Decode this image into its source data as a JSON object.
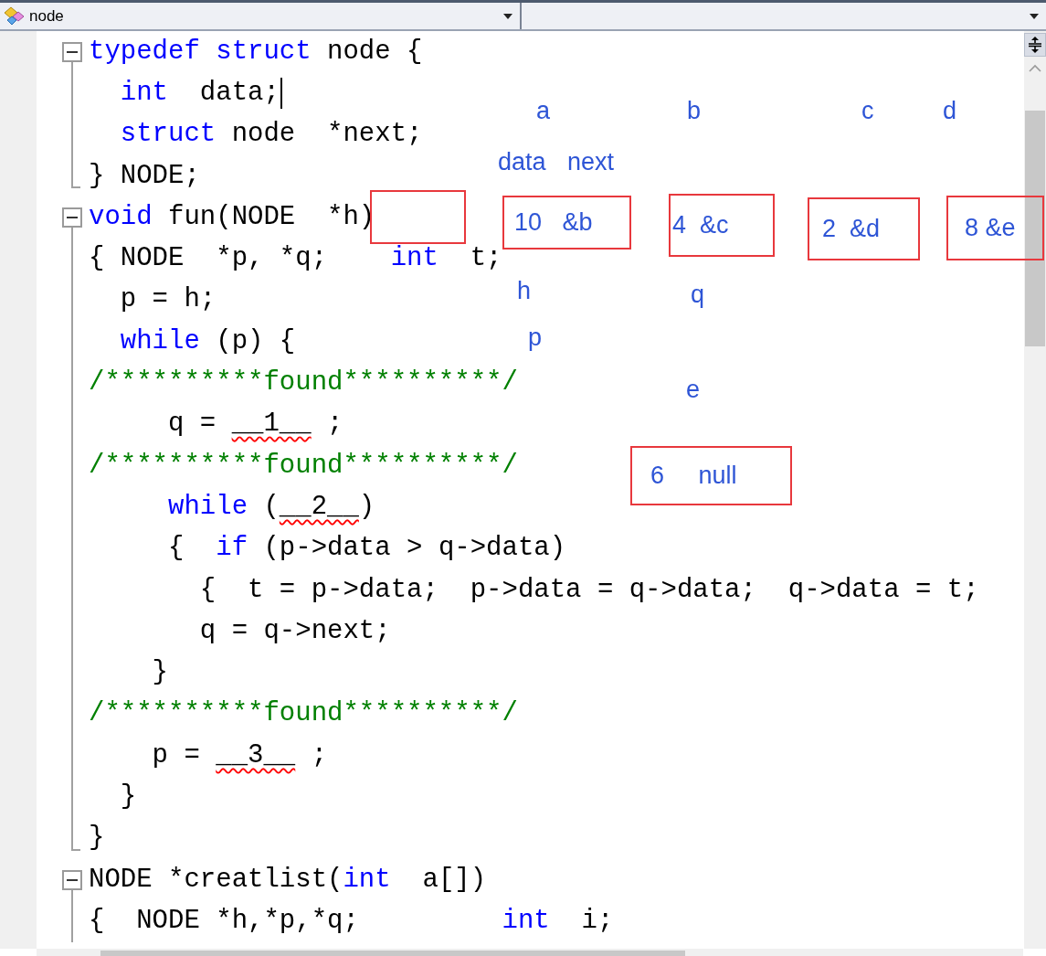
{
  "toolbar": {
    "scope_dropdown": {
      "value": "node"
    }
  },
  "code_lines": [
    {
      "kind": "fold_start",
      "caret": false,
      "tokens": [
        {
          "kind": "kw",
          "text": "typedef struct"
        },
        {
          "kind": "plain",
          "text": " node {"
        }
      ]
    },
    {
      "kind": "body",
      "caret": true,
      "tokens": [
        {
          "kind": "kw",
          "text": "  int"
        },
        {
          "kind": "plain",
          "text": "  data;"
        }
      ]
    },
    {
      "kind": "body",
      "caret": false,
      "tokens": [
        {
          "kind": "kw",
          "text": "  struct"
        },
        {
          "kind": "plain",
          "text": " node  *next;"
        }
      ]
    },
    {
      "kind": "fold_end",
      "caret": false,
      "tokens": [
        {
          "kind": "plain",
          "text": "} NODE;"
        }
      ]
    },
    {
      "kind": "fold_start",
      "caret": false,
      "tokens": [
        {
          "kind": "kw",
          "text": "void"
        },
        {
          "kind": "plain",
          "text": " fun(NODE  *h)"
        }
      ]
    },
    {
      "kind": "body",
      "caret": false,
      "tokens": [
        {
          "kind": "plain",
          "text": "{ NODE  *p, *q;    "
        },
        {
          "kind": "kw",
          "text": "int"
        },
        {
          "kind": "plain",
          "text": "  t;"
        }
      ]
    },
    {
      "kind": "body",
      "caret": false,
      "tokens": [
        {
          "kind": "plain",
          "text": "  p = h;"
        }
      ]
    },
    {
      "kind": "body",
      "caret": false,
      "tokens": [
        {
          "kind": "kw",
          "text": "  while"
        },
        {
          "kind": "plain",
          "text": " (p) {"
        }
      ]
    },
    {
      "kind": "body",
      "caret": false,
      "tokens": [
        {
          "kind": "comment",
          "text": "/**********found**********/"
        }
      ]
    },
    {
      "kind": "body",
      "caret": false,
      "tokens": [
        {
          "kind": "plain",
          "text": "     q = "
        },
        {
          "kind": "blank",
          "text": "__1__"
        },
        {
          "kind": "plain",
          "text": " ;"
        }
      ]
    },
    {
      "kind": "body",
      "caret": false,
      "tokens": [
        {
          "kind": "comment",
          "text": "/**********found**********/"
        }
      ]
    },
    {
      "kind": "body",
      "caret": false,
      "tokens": [
        {
          "kind": "kw",
          "text": "     while"
        },
        {
          "kind": "plain",
          "text": " ("
        },
        {
          "kind": "blank",
          "text": "__2__"
        },
        {
          "kind": "plain",
          "text": ")"
        }
      ]
    },
    {
      "kind": "body",
      "caret": false,
      "tokens": [
        {
          "kind": "plain",
          "text": "     {  "
        },
        {
          "kind": "kw",
          "text": "if"
        },
        {
          "kind": "plain",
          "text": " (p->data > q->data)"
        }
      ]
    },
    {
      "kind": "body",
      "caret": false,
      "tokens": [
        {
          "kind": "plain",
          "text": "       {  t = p->data;  p->data = q->data;  q->data = t;"
        }
      ]
    },
    {
      "kind": "body",
      "caret": false,
      "tokens": [
        {
          "kind": "plain",
          "text": "       q = q->next;"
        }
      ]
    },
    {
      "kind": "body",
      "caret": false,
      "tokens": [
        {
          "kind": "plain",
          "text": "    }"
        }
      ]
    },
    {
      "kind": "body",
      "caret": false,
      "tokens": [
        {
          "kind": "comment",
          "text": "/**********found**********/"
        }
      ]
    },
    {
      "kind": "body",
      "caret": false,
      "tokens": [
        {
          "kind": "plain",
          "text": "    p = "
        },
        {
          "kind": "blank",
          "text": "__3__"
        },
        {
          "kind": "plain",
          "text": " ;"
        }
      ]
    },
    {
      "kind": "body",
      "caret": false,
      "tokens": [
        {
          "kind": "plain",
          "text": "  }"
        }
      ]
    },
    {
      "kind": "fold_end",
      "caret": false,
      "tokens": [
        {
          "kind": "plain",
          "text": "}"
        }
      ]
    },
    {
      "kind": "fold_start",
      "caret": false,
      "tokens": [
        {
          "kind": "plain",
          "text": "NODE *creatlist("
        },
        {
          "kind": "kw",
          "text": "int"
        },
        {
          "kind": "plain",
          "text": "  a[])"
        }
      ]
    },
    {
      "kind": "body",
      "caret": false,
      "tokens": [
        {
          "kind": "plain",
          "text": "{  NODE *h,*p,*q;         "
        },
        {
          "kind": "kw",
          "text": "int"
        },
        {
          "kind": "plain",
          "text": "  i;"
        }
      ]
    }
  ],
  "annotations": [
    {
      "kind": "label",
      "text": "a"
    },
    {
      "kind": "label",
      "text": "b"
    },
    {
      "kind": "label",
      "text": "c"
    },
    {
      "kind": "label",
      "text": "d"
    },
    {
      "kind": "label",
      "text": "data"
    },
    {
      "kind": "label",
      "text": "next"
    },
    {
      "kind": "box"
    },
    {
      "kind": "box",
      "text": "10   &b"
    },
    {
      "kind": "box",
      "text": "4  &c"
    },
    {
      "kind": "box",
      "text": "2  &d"
    },
    {
      "kind": "box",
      "text": "8 &e"
    },
    {
      "kind": "label",
      "text": "h"
    },
    {
      "kind": "label",
      "text": "q"
    },
    {
      "kind": "label",
      "text": "p"
    },
    {
      "kind": "label",
      "text": "e"
    },
    {
      "kind": "box",
      "text": "6     null"
    }
  ]
}
